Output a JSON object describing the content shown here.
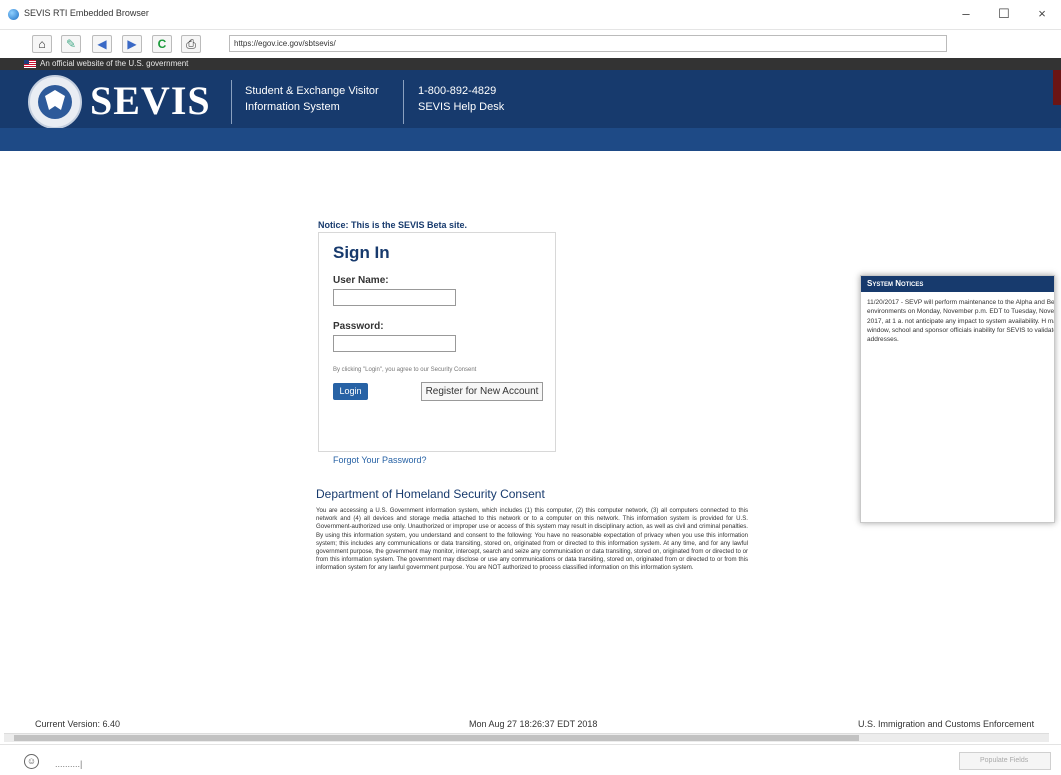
{
  "window": {
    "title": "SEVIS RTI Embedded Browser",
    "minimize": "–",
    "maximize": "☐",
    "close": "×"
  },
  "toolbar": {
    "url": "https://egov.ice.gov/sbtsevis/"
  },
  "gov_banner": {
    "text": "An official website of the U.S. government"
  },
  "header": {
    "brand": "SEVIS",
    "system_line1": "Student & Exchange Visitor",
    "system_line2": "Information System",
    "phone": "1-800-892-4829",
    "helpdesk": "SEVIS Help Desk"
  },
  "signin": {
    "notice": "Notice: This is the SEVIS Beta site.",
    "title": "Sign In",
    "username_label": "User Name:",
    "password_label": "Password:",
    "consent_note": "By clicking \"Login\", you agree to our Security Consent",
    "login_label": "Login",
    "register_label": "Register for New Account",
    "forgot_label": "Forgot Your Password?"
  },
  "consent": {
    "title": "Department of Homeland Security Consent",
    "body": "You are accessing a U.S. Government information system, which includes (1) this computer, (2) this computer network, (3) all computers connected to this network and (4) all devices and storage media attached to this network or to a computer on this network. This information system is provided for U.S. Government-authorized use only. Unauthorized or improper use or access of this system may result in disciplinary action, as well as civil and criminal penalties. By using this information system, you understand and consent to the following: You have no reasonable expectation of privacy when you use this information system; this includes any communications or data transiting, stored on, originated from or directed to this information system. At any time, and for any lawful government purpose, the government may monitor, intercept, search and seize any communication or data transiting, stored on, originated from or directed to or from this information system. The government may disclose or use any communications or data transiting, stored on, originated from or directed to or from this information system for any lawful government purpose. You are NOT authorized to process classified information on this information system."
  },
  "notices": {
    "title": "System Notices",
    "body": "11/20/2017 - SEVP will perform maintenance to the Alpha and Beta environments on Monday, November p.m. EDT to Tuesday, November 21, 2017, at 1 a. not anticipate any impact to system availability. H maintenance window, school and sponsor officials inability for SEVIS to validate U.S. addresses."
  },
  "status": {
    "version": "Current Version: 6.40",
    "datetime": "Mon Aug 27 18:26:37 EDT 2018",
    "agency": "U.S. Immigration and Customs Enforcement"
  },
  "bottom": {
    "input_text": "..........|",
    "populate_label": "Populate Fields"
  }
}
